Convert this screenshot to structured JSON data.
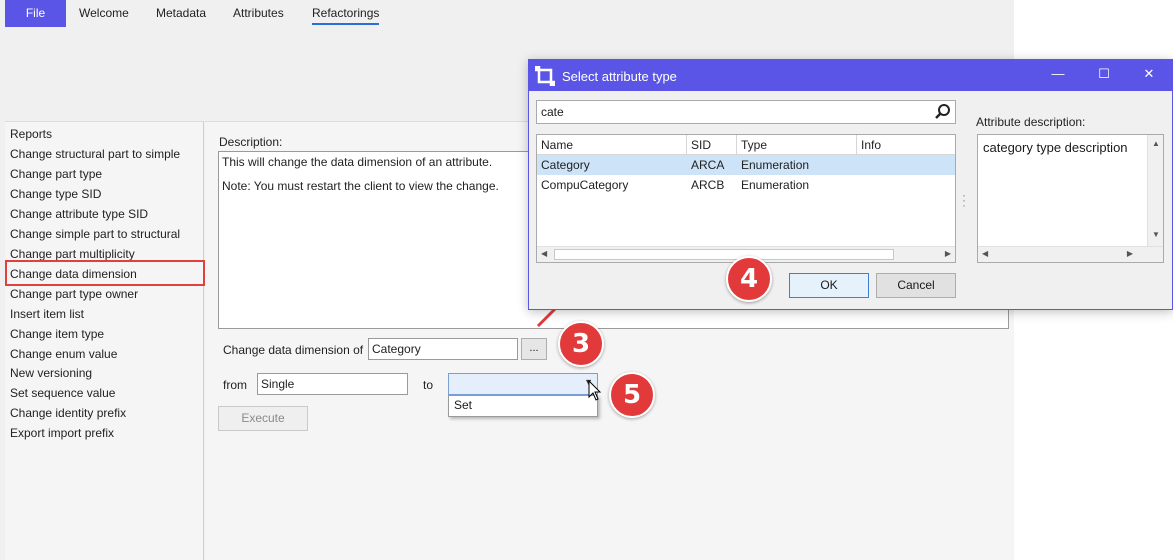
{
  "tabs": {
    "file": "File",
    "welcome": "Welcome",
    "metadata": "Metadata",
    "attributes": "Attributes",
    "refactorings": "Refactorings"
  },
  "nav": {
    "items": [
      "Reports",
      "Change structural part to simple",
      "Change part type",
      "Change type SID",
      "Change attribute type SID",
      "Change simple part to structural",
      "Change part multiplicity",
      "Change data dimension",
      "Change part type owner",
      "Insert item list",
      "Change item type",
      "Change enum value",
      "New versioning",
      "Set sequence value",
      "Change identity prefix",
      "Export import prefix"
    ],
    "selected_index": 7
  },
  "content": {
    "description_label": "Description:",
    "description_line1": "This will change the data dimension of an attribute.",
    "description_line2": "Note: You must restart the client to view the change.",
    "change_label": "Change data dimension of",
    "change_value": "Category",
    "browse_label": "...",
    "from_label": "from",
    "from_value": "Single",
    "to_label": "to",
    "to_value": "",
    "dropdown_option": "Set",
    "execute_label": "Execute"
  },
  "dialog": {
    "title": "Select attribute type",
    "search_value": "cate",
    "columns": [
      "Name",
      "SID",
      "Type",
      "Info"
    ],
    "rows": [
      {
        "name": "Category",
        "sid": "ARCA",
        "type": "Enumeration",
        "info": ""
      },
      {
        "name": "CompuCategory",
        "sid": "ARCB",
        "type": "Enumeration",
        "info": ""
      }
    ],
    "attr_desc_label": "Attribute description:",
    "attr_desc_value": "category type description",
    "ok_label": "OK",
    "cancel_label": "Cancel"
  },
  "badges": {
    "b3": "3",
    "b4": "4",
    "b5": "5"
  },
  "colors": {
    "accent": "#5a55e6",
    "badge": "#e23a3a",
    "highlight_border": "#e0403e",
    "selection": "#cde3f7"
  }
}
